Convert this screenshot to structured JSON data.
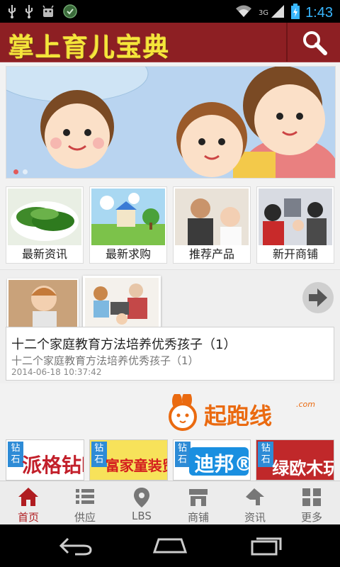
{
  "status_bar": {
    "time": "1:43",
    "network": "3G",
    "icons_left": [
      "usb-icon",
      "usb-icon",
      "android-debug-icon",
      "security-icon"
    ],
    "icons_right": [
      "wifi-icon",
      "signal-icon",
      "battery-icon"
    ]
  },
  "app_bar": {
    "title": "掌上育儿宝典",
    "search_icon": "search-icon"
  },
  "banner": {
    "slides": 2,
    "active_slide": 1
  },
  "quick_links": [
    {
      "label": "最新资讯"
    },
    {
      "label": "最新求购"
    },
    {
      "label": "推荐产品"
    },
    {
      "label": "新开商铺"
    }
  ],
  "news": {
    "title": "十二个家庭教育方法培养优秀孩子（1）",
    "subtitle": "十二个家庭教育方法培养优秀孩子（1）",
    "date": "2014-06-18 10:37:42"
  },
  "brand": {
    "name": "起跑线",
    "domain": ".com"
  },
  "ads": [
    {
      "tag": "钻石",
      "text": "派格钻时",
      "color": "#c21f2a",
      "bg": "#ffffff"
    },
    {
      "tag": "钻石",
      "text": "富家童装贸易",
      "color": "#d41e1e",
      "bg": "#f7e25a"
    },
    {
      "tag": "钻石",
      "text": "迪邦®",
      "color": "#ffffff",
      "bg": "#1a8fe0"
    },
    {
      "tag": "钻石",
      "text": "绿欧木玩",
      "color": "#ffffff",
      "bg": "#c0282a"
    }
  ],
  "tabs": [
    {
      "label": "首页",
      "icon": "home-icon",
      "active": true
    },
    {
      "label": "供应",
      "icon": "list-icon",
      "active": false
    },
    {
      "label": "LBS",
      "icon": "location-pin-icon",
      "active": false
    },
    {
      "label": "商铺",
      "icon": "store-icon",
      "active": false
    },
    {
      "label": "资讯",
      "icon": "news-icon",
      "active": false
    },
    {
      "label": "更多",
      "icon": "grid-icon",
      "active": false
    }
  ],
  "colors": {
    "brand_red": "#8d1f23",
    "title_yellow": "#f5e63a",
    "active_tab": "#b01d21",
    "brand_orange": "#ea6a10"
  }
}
